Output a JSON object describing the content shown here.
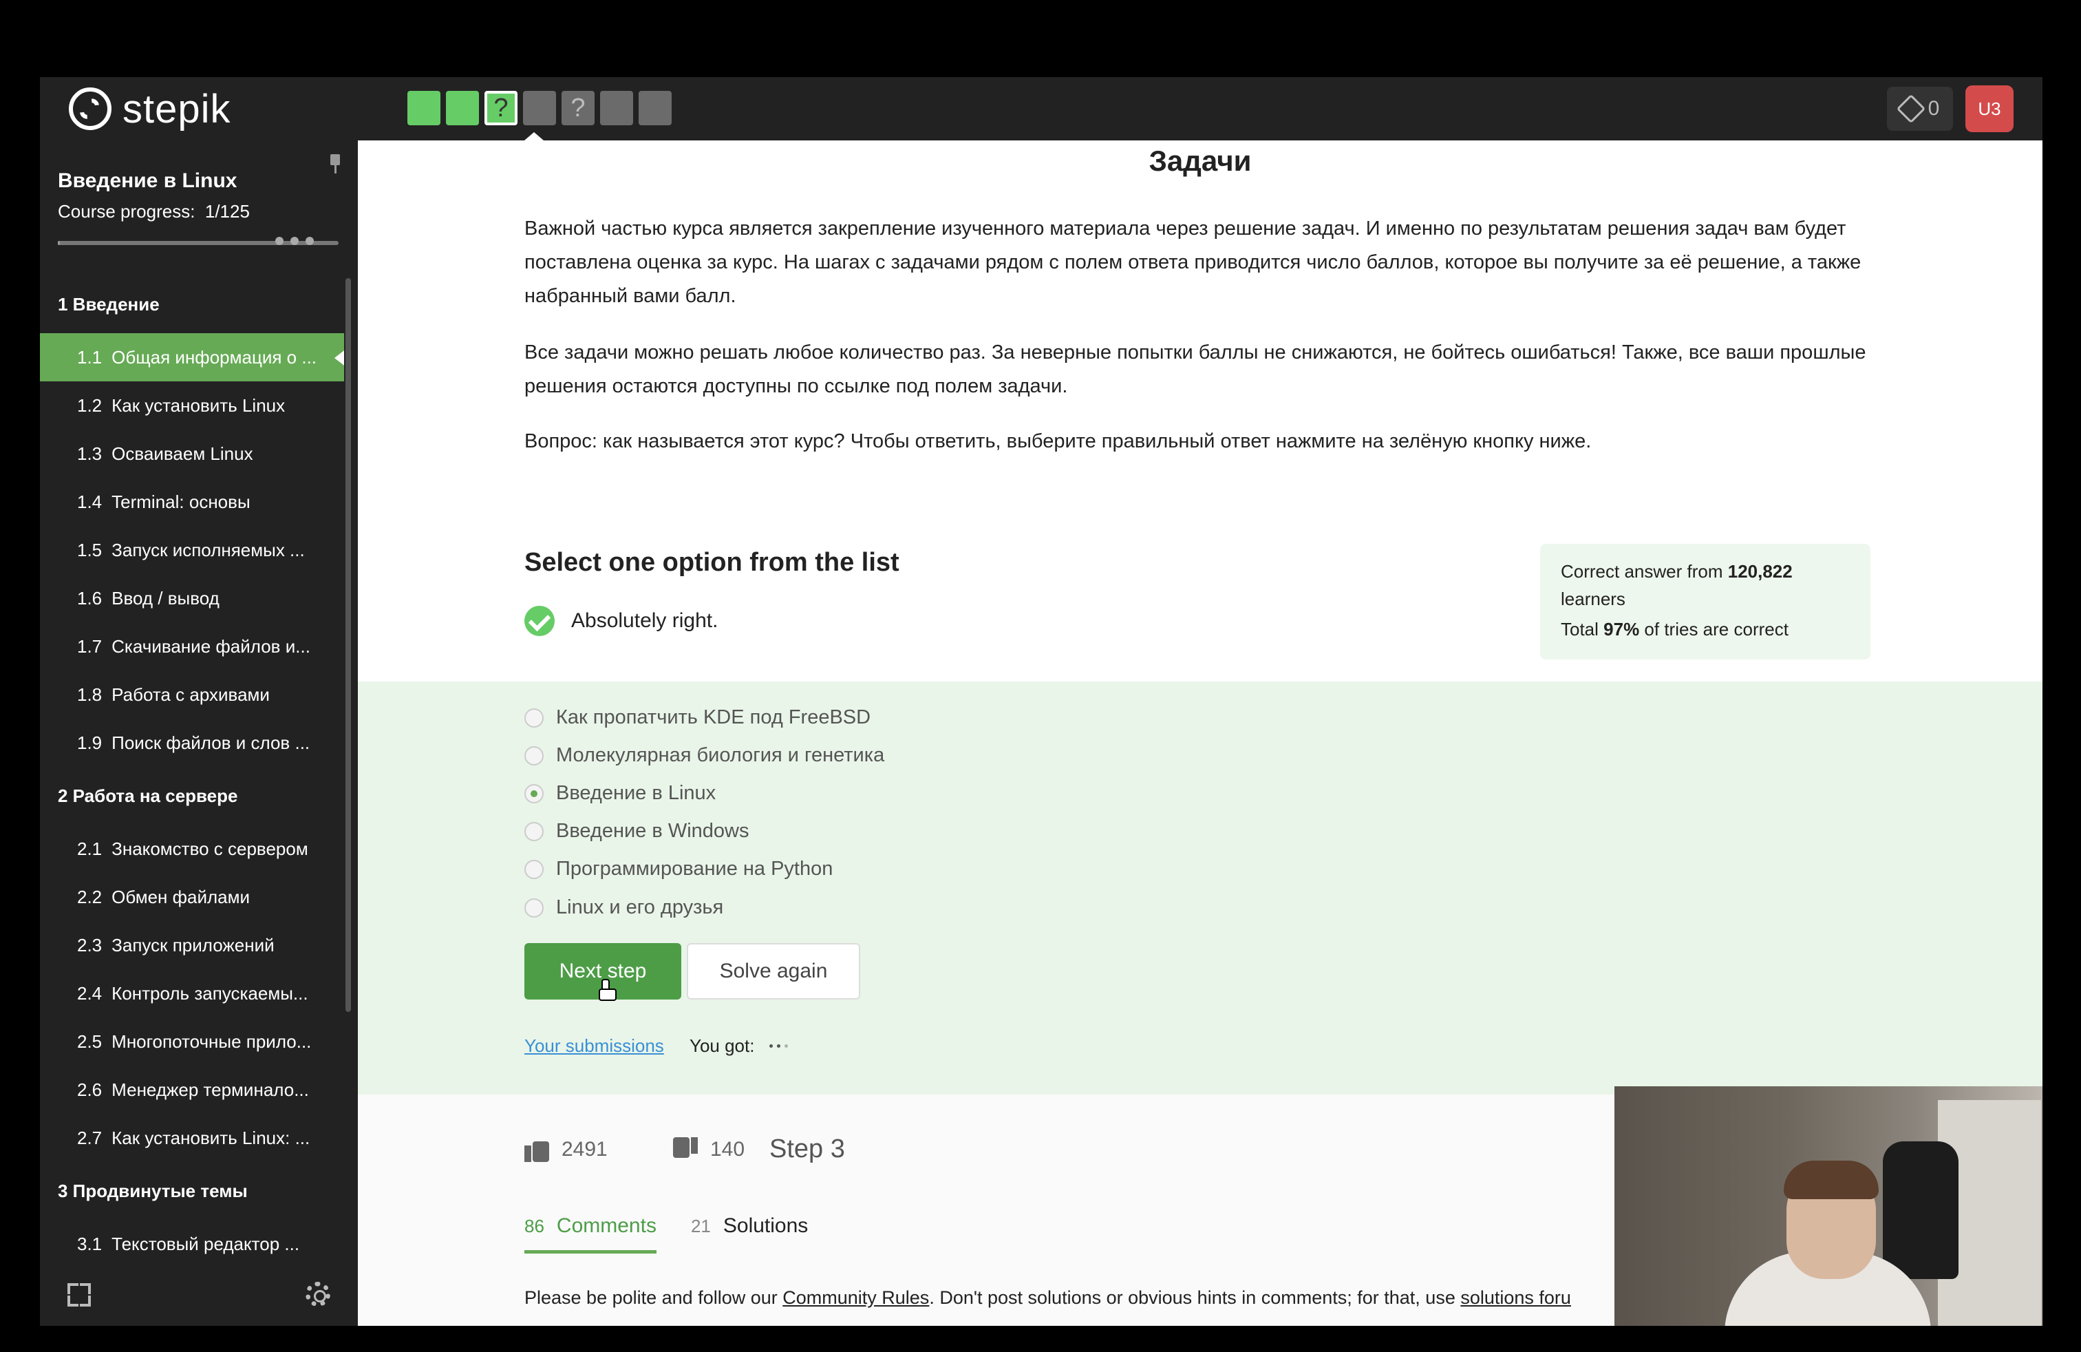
{
  "brand": {
    "name": "stepik"
  },
  "topbar": {
    "step_markers": [
      {
        "state": "done",
        "label": ""
      },
      {
        "state": "done",
        "label": ""
      },
      {
        "state": "current",
        "label": "?"
      },
      {
        "state": "todo",
        "label": ""
      },
      {
        "state": "todo",
        "label": "?"
      },
      {
        "state": "todo",
        "label": ""
      },
      {
        "state": "todo",
        "label": ""
      }
    ],
    "points": "0",
    "avatar_initials": "U3"
  },
  "sidebar": {
    "course_title": "Введение в Linux",
    "course_progress_label": "Course progress:",
    "course_progress_value": "1/125",
    "progress_fraction": 0.008,
    "sections": [
      {
        "title": "1  Введение",
        "lessons": [
          {
            "num": "1.1",
            "title": "Общая информация о ...",
            "active": true
          },
          {
            "num": "1.2",
            "title": "Как установить Linux"
          },
          {
            "num": "1.3",
            "title": "Осваиваем Linux"
          },
          {
            "num": "1.4",
            "title": "Terminal: основы"
          },
          {
            "num": "1.5",
            "title": "Запуск исполняемых ..."
          },
          {
            "num": "1.6",
            "title": "Ввод / вывод"
          },
          {
            "num": "1.7",
            "title": "Скачивание файлов и..."
          },
          {
            "num": "1.8",
            "title": "Работа с архивами"
          },
          {
            "num": "1.9",
            "title": "Поиск файлов и слов ..."
          }
        ]
      },
      {
        "title": "2  Работа на сервере",
        "lessons": [
          {
            "num": "2.1",
            "title": "Знакомство с сервером"
          },
          {
            "num": "2.2",
            "title": "Обмен файлами"
          },
          {
            "num": "2.3",
            "title": "Запуск приложений"
          },
          {
            "num": "2.4",
            "title": "Контроль запускаемы..."
          },
          {
            "num": "2.5",
            "title": "Многопоточные прило..."
          },
          {
            "num": "2.6",
            "title": "Менеджер терминало..."
          },
          {
            "num": "2.7",
            "title": "Как установить Linux: ..."
          }
        ]
      },
      {
        "title": "3  Продвинутые темы",
        "lessons": [
          {
            "num": "3.1",
            "title": "Текстовый редактор ..."
          }
        ]
      }
    ]
  },
  "main": {
    "heading": "Задачи",
    "paragraphs": [
      "Важной частью курса является закрепление изученного материала через решение задач. И именно по результатам решения задач вам будет поставлена оценка за курс. На шагах с задачами рядом с полем ответа приводится число баллов, которое вы получите за её решение, а также набранный вами балл.",
      "Все задачи можно решать любое количество раз. За неверные попытки баллы не снижаются, не бойтесь ошибаться! Также, все ваши прошлые решения остаются доступны по ссылке под полем задачи.",
      "Вопрос: как называется этот курс? Чтобы ответить, выберите правильный ответ нажмите на зелёную кнопку ниже."
    ],
    "quiz": {
      "title": "Select one option from the list",
      "feedback": "Absolutely right.",
      "stats": {
        "line1_prefix": "Correct answer from ",
        "learners_count": "120,822",
        "line1_suffix": "learners",
        "line2_prefix": "Total ",
        "percent": "97%",
        "line2_suffix": " of tries are correct"
      },
      "options": [
        {
          "label": "Как пропатчить KDE под FreeBSD",
          "selected": false
        },
        {
          "label": "Молекулярная биология и генетика",
          "selected": false
        },
        {
          "label": "Введение в Linux",
          "selected": true
        },
        {
          "label": "Введение в Windows",
          "selected": false
        },
        {
          "label": "Программирование на Python",
          "selected": false
        },
        {
          "label": "Linux и его друзья",
          "selected": false
        }
      ],
      "next_button": "Next step",
      "again_button": "Solve again",
      "submissions_link": "Your submissions",
      "you_got": "You got:"
    },
    "likes": "2491",
    "dislikes": "140",
    "step_label": "Step 3",
    "tabs": [
      {
        "count": "86",
        "label": "Comments",
        "active": true
      },
      {
        "count": "21",
        "label": "Solutions",
        "active": false
      }
    ],
    "rules": {
      "prefix": "Please be polite and follow our ",
      "link1": "Community Rules",
      "middle": ". Don't post solutions or obvious hints in comments; for that, use ",
      "link2": "solutions foru"
    }
  },
  "colors": {
    "brand_green": "#66aa55",
    "button_green": "#4d9d47",
    "sidebar_bg": "#222222",
    "answer_bg": "#e9f5e8",
    "link_blue": "#3a8fd6",
    "avatar_red": "#d44b4b"
  }
}
